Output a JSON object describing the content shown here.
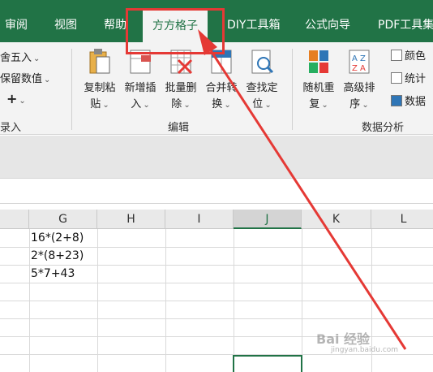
{
  "ribbon_tabs": {
    "review": "审阅",
    "view": "视图",
    "help": "帮助",
    "fangfang": "方方格子",
    "diy": "DIY工具箱",
    "formula_wizard": "公式向导",
    "pdf": "PDF工具集"
  },
  "left_group": {
    "round": "舍五入",
    "keep_value": "保留数值",
    "plus": "+",
    "label": "录入"
  },
  "edit_group": {
    "copy_paste_1": "复制粘",
    "copy_paste_2": "贴",
    "insert_1": "新增插",
    "insert_2": "入",
    "batch_delete_1": "批量删",
    "batch_delete_2": "除",
    "merge_1": "合并转",
    "merge_2": "换",
    "find_1": "查找定",
    "find_2": "位",
    "label": "编辑"
  },
  "analysis_group": {
    "random_1": "随机重",
    "random_2": "复",
    "sort_1": "高级排",
    "sort_2": "序",
    "color": "颜色",
    "stats": "统计",
    "data": "数据",
    "label": "数据分析"
  },
  "columns": [
    "G",
    "H",
    "I",
    "J",
    "K",
    "L"
  ],
  "selected_column": "J",
  "cells": {
    "g1": "16*(2+8)",
    "g2": "2*(8+23)",
    "g3": "5*7+43"
  },
  "watermark": {
    "line1": "Bai 经验",
    "line2": "jingyan.baidu.com"
  },
  "colors": {
    "excel_green": "#217346",
    "annotation_red": "#e53935"
  }
}
